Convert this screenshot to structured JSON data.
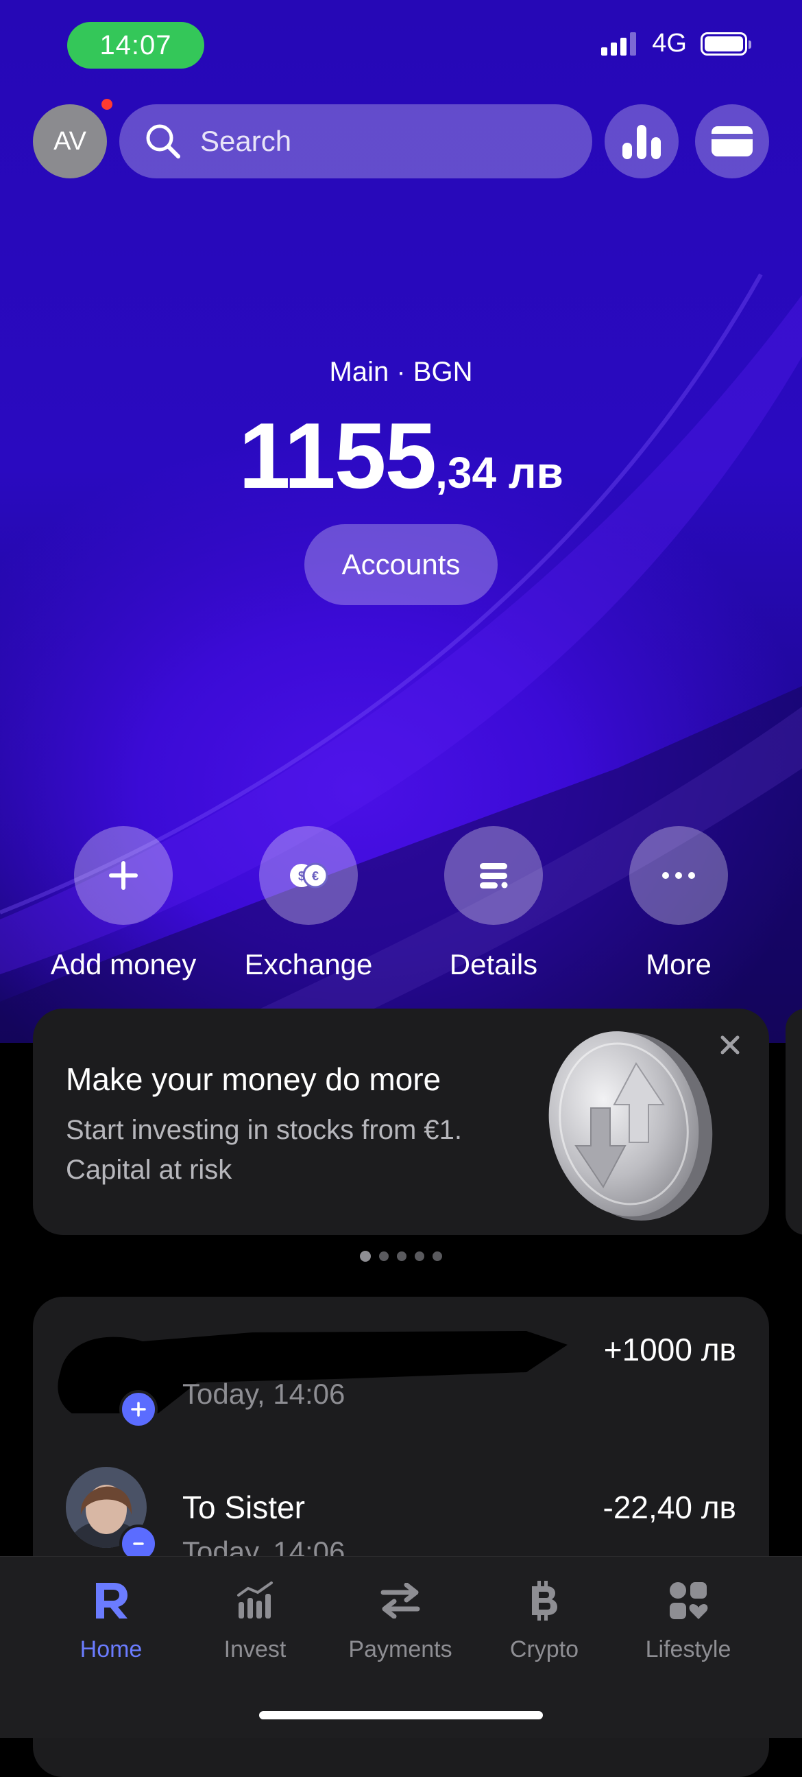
{
  "status_bar": {
    "time": "14:07",
    "network": "4G"
  },
  "header": {
    "avatar_initials": "AV",
    "search_placeholder": "Search"
  },
  "account": {
    "label": "Main · BGN",
    "balance_int": "1155",
    "balance_frac": ",34 лв",
    "accounts_button": "Accounts"
  },
  "actions": [
    {
      "label": "Add money",
      "icon": "plus-icon"
    },
    {
      "label": "Exchange",
      "icon": "exchange-icon"
    },
    {
      "label": "Details",
      "icon": "details-icon"
    },
    {
      "label": "More",
      "icon": "more-icon"
    }
  ],
  "promo": {
    "title": "Make your money do more",
    "subtitle": "Start investing in stocks from €1. Capital at risk",
    "pages": 5,
    "active_page": 1
  },
  "transactions": [
    {
      "name": "",
      "date": "Today, 14:06",
      "amount": "+1000 лв"
    },
    {
      "name": "To Sister",
      "date": "Today, 14:06",
      "amount": "-22,40 лв"
    }
  ],
  "tabs": [
    {
      "label": "Home",
      "icon": "revolut-r-icon",
      "active": true
    },
    {
      "label": "Invest",
      "icon": "invest-chart-icon",
      "active": false
    },
    {
      "label": "Payments",
      "icon": "transfer-arrows-icon",
      "active": false
    },
    {
      "label": "Crypto",
      "icon": "bitcoin-icon",
      "active": false
    },
    {
      "label": "Lifestyle",
      "icon": "lifestyle-icon",
      "active": false
    }
  ],
  "colors": {
    "accent": "#6b7cff",
    "status_pill": "#34c759",
    "hero": "#2a0ac0",
    "card": "#1c1c1e"
  }
}
